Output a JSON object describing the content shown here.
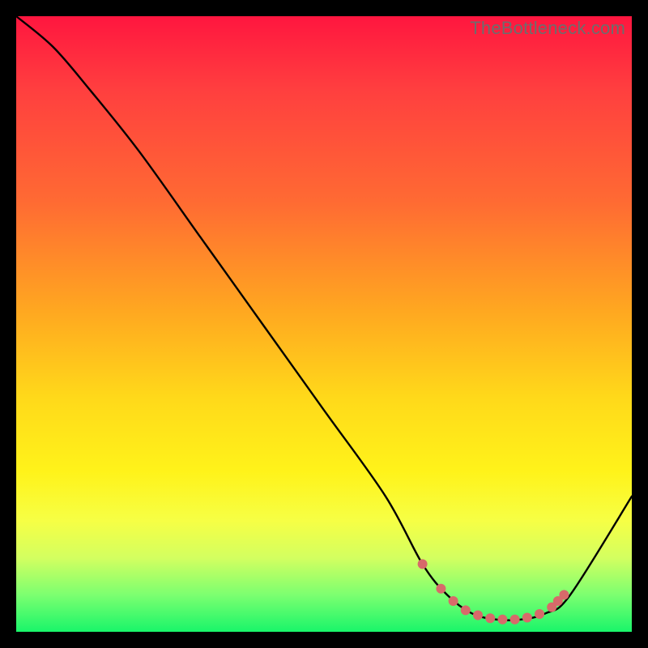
{
  "watermark": "TheBottleneck.com",
  "chart_data": {
    "type": "line",
    "title": "",
    "xlabel": "",
    "ylabel": "",
    "xlim": [
      0,
      100
    ],
    "ylim": [
      0,
      100
    ],
    "series": [
      {
        "name": "bottleneck-curve",
        "x": [
          0,
          6,
          12,
          20,
          30,
          40,
          50,
          60,
          66,
          70,
          74,
          78,
          82,
          86,
          90,
          100
        ],
        "values": [
          100,
          95,
          88,
          78,
          64,
          50,
          36,
          22,
          11,
          6,
          3,
          2,
          2,
          3,
          6,
          22
        ]
      }
    ],
    "markers": {
      "name": "highlight-dots",
      "x": [
        66,
        69,
        71,
        73,
        75,
        77,
        79,
        81,
        83,
        85,
        87,
        88,
        89
      ],
      "values": [
        11,
        7,
        5,
        3.5,
        2.7,
        2.2,
        2,
        2,
        2.3,
        2.9,
        4,
        5,
        6
      ],
      "color": "#d76a6a",
      "radius": 6
    }
  }
}
